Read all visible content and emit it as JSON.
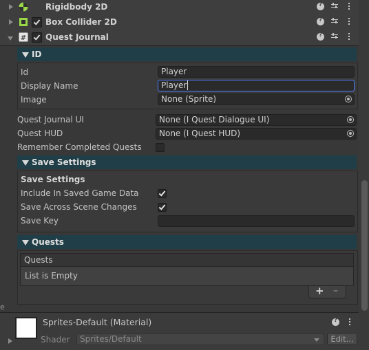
{
  "components": {
    "rigidbody": {
      "title": "Rigidbody 2D"
    },
    "box_collider": {
      "title": "Box Collider 2D"
    },
    "quest_journal": {
      "title": "Quest Journal"
    }
  },
  "id_section": {
    "header": "ID",
    "id_label": "Id",
    "id_value": "Player",
    "display_name_label": "Display Name",
    "display_name_value": "Player",
    "image_label": "Image",
    "image_value": "None (Sprite)"
  },
  "fields": {
    "quest_journal_ui_label": "Quest Journal UI",
    "quest_journal_ui_value": "None (I Quest Dialogue UI)",
    "quest_hud_label": "Quest HUD",
    "quest_hud_value": "None (I Quest HUD)",
    "remember_label": "Remember Completed Quests",
    "remember_checked": false
  },
  "save_settings": {
    "header": "Save Settings",
    "subheader": "Save Settings",
    "include_label": "Include In Saved Game Data",
    "include_checked": true,
    "across_label": "Save Across Scene Changes",
    "across_checked": true,
    "key_label": "Save Key",
    "key_value": ""
  },
  "quests": {
    "header": "Quests",
    "list_title": "Quests",
    "empty_text": "List is Empty",
    "add_label": "+",
    "remove_label": "–"
  },
  "material": {
    "title": "Sprites-Default (Material)",
    "shader_label": "Shader",
    "shader_value": "Sprites/Default",
    "edit_label": "Edit..."
  }
}
